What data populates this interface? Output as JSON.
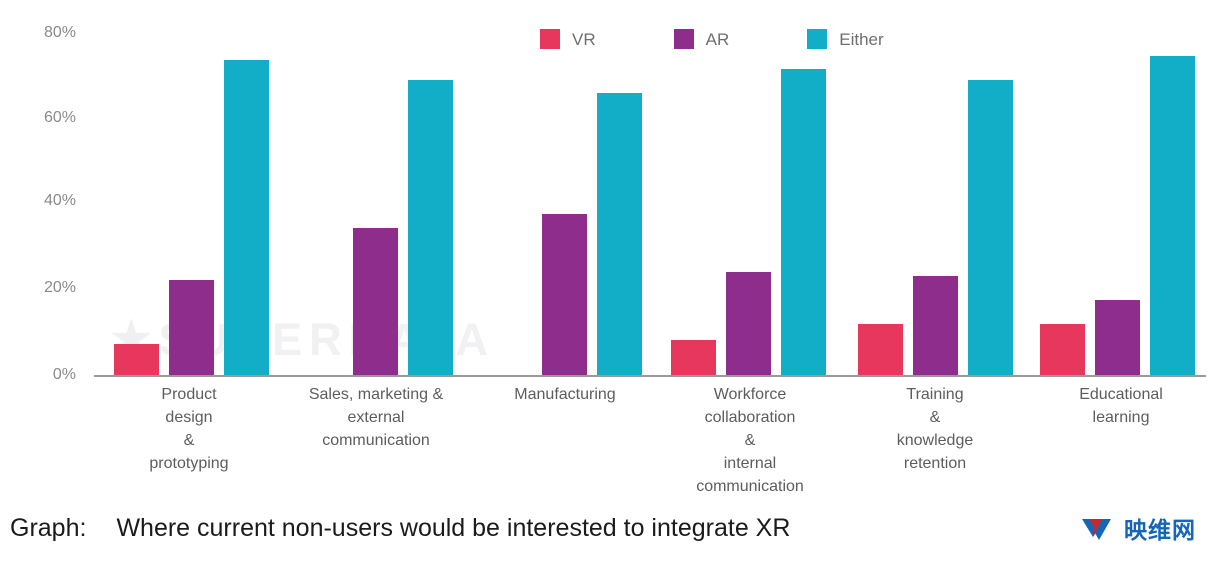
{
  "chart_data": {
    "type": "bar",
    "title": "Where current non-users would be interested to integrate XR",
    "xlabel": "",
    "ylabel": "",
    "ylim": [
      0,
      80
    ],
    "grid": false,
    "legend_position": "top-center",
    "ytick_labels": [
      "80%",
      "60%",
      "40%",
      "20%",
      "0%"
    ],
    "ytick_values": [
      80,
      60,
      40,
      20,
      0
    ],
    "categories": [
      "Product design & prototyping",
      "Sales, marketing & external communication",
      "Manufacturing",
      "Workforce collaboration & internal communication",
      "Training & knowledge retention",
      "Educational learning"
    ],
    "category_lines": [
      [
        "Product",
        "design",
        "&",
        "prototyping"
      ],
      [
        "Sales, marketing &",
        "external",
        "communication"
      ],
      [
        "Manufacturing"
      ],
      [
        "Workforce",
        "collaboration",
        "&",
        "internal",
        "communication"
      ],
      [
        "Training",
        "&",
        "knowledge",
        "retention"
      ],
      [
        "Educational",
        "learning"
      ]
    ],
    "series": [
      {
        "name": "VR",
        "color": "#E8375C",
        "values": [
          7,
          null,
          null,
          8,
          11.5,
          11.5
        ]
      },
      {
        "name": "AR",
        "color": "#8E2D8B",
        "values": [
          21.5,
          33.5,
          36.5,
          23.5,
          22.5,
          17
        ]
      },
      {
        "name": "Either",
        "color": "#12AEC7",
        "values": [
          71.5,
          67,
          64,
          69.5,
          67,
          72.5
        ]
      }
    ]
  },
  "legend": {
    "items": [
      {
        "label": "VR",
        "color": "#E8375C"
      },
      {
        "label": "AR",
        "color": "#8E2D8B"
      },
      {
        "label": "Either",
        "color": "#12AEC7"
      }
    ]
  },
  "watermark": {
    "star_glyph": "★",
    "text": "SUPERDATA"
  },
  "caption": {
    "prefix": "Graph:",
    "text": "Where current non-users would be interested to integrate XR"
  },
  "logo": {
    "text": "映维网",
    "mark_colors": {
      "red": "#D0252B",
      "blue": "#1666B8"
    }
  }
}
